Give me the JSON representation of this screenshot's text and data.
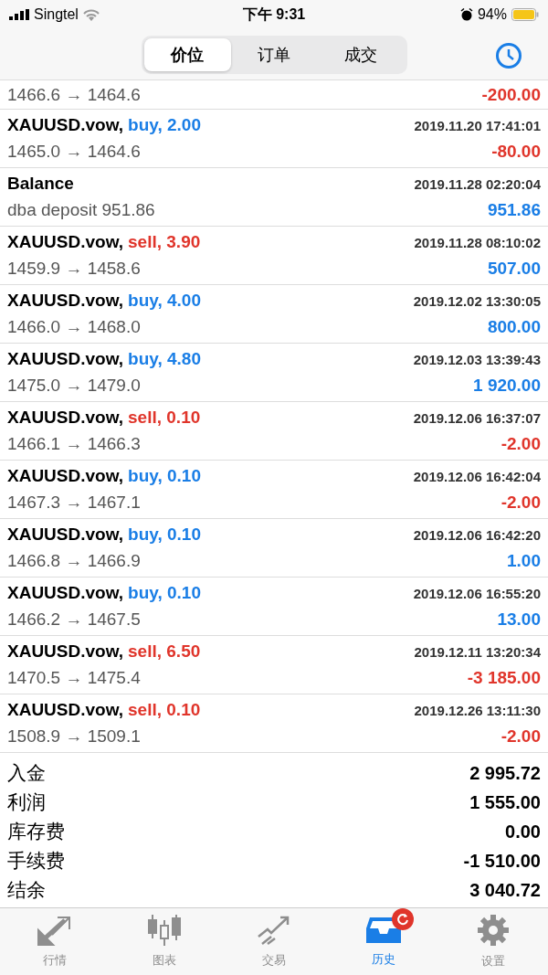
{
  "status_bar": {
    "carrier": "Singtel",
    "time": "下午 9:31",
    "battery": "94%"
  },
  "segments": [
    {
      "label": "价位",
      "selected": true
    },
    {
      "label": "订单",
      "selected": false
    },
    {
      "label": "成交",
      "selected": false
    }
  ],
  "deals": [
    {
      "kind": "partial",
      "prices": "1466.6 → 1464.6",
      "profit": "-200.00",
      "negative": true
    },
    {
      "kind": "trade",
      "symbol": "XAUUSD.vow,",
      "sell": false,
      "order": "buy, 2.00",
      "time": "2019.11.20 17:41:01",
      "prices": "1465.0 → 1464.6",
      "profit": "-80.00",
      "negative": true
    },
    {
      "kind": "balance",
      "symbol": "Balance",
      "time": "2019.11.28 02:20:04",
      "prices": "dba deposit 951.86",
      "profit": "951.86",
      "negative": false
    },
    {
      "kind": "trade",
      "symbol": "XAUUSD.vow,",
      "sell": true,
      "order": "sell, 3.90",
      "time": "2019.11.28 08:10:02",
      "prices": "1459.9 → 1458.6",
      "profit": "507.00",
      "negative": false
    },
    {
      "kind": "trade",
      "symbol": "XAUUSD.vow,",
      "sell": false,
      "order": "buy, 4.00",
      "time": "2019.12.02 13:30:05",
      "prices": "1466.0 → 1468.0",
      "profit": "800.00",
      "negative": false
    },
    {
      "kind": "trade",
      "symbol": "XAUUSD.vow,",
      "sell": false,
      "order": "buy, 4.80",
      "time": "2019.12.03 13:39:43",
      "prices": "1475.0 → 1479.0",
      "profit": "1 920.00",
      "negative": false
    },
    {
      "kind": "trade",
      "symbol": "XAUUSD.vow,",
      "sell": true,
      "order": "sell, 0.10",
      "time": "2019.12.06 16:37:07",
      "prices": "1466.1 → 1466.3",
      "profit": "-2.00",
      "negative": true
    },
    {
      "kind": "trade",
      "symbol": "XAUUSD.vow,",
      "sell": false,
      "order": "buy, 0.10",
      "time": "2019.12.06 16:42:04",
      "prices": "1467.3 → 1467.1",
      "profit": "-2.00",
      "negative": true
    },
    {
      "kind": "trade",
      "symbol": "XAUUSD.vow,",
      "sell": false,
      "order": "buy, 0.10",
      "time": "2019.12.06 16:42:20",
      "prices": "1466.8 → 1466.9",
      "profit": "1.00",
      "negative": false
    },
    {
      "kind": "trade",
      "symbol": "XAUUSD.vow,",
      "sell": false,
      "order": "buy, 0.10",
      "time": "2019.12.06 16:55:20",
      "prices": "1466.2 → 1467.5",
      "profit": "13.00",
      "negative": false
    },
    {
      "kind": "trade",
      "symbol": "XAUUSD.vow,",
      "sell": true,
      "order": "sell, 6.50",
      "time": "2019.12.11 13:20:34",
      "prices": "1470.5 → 1475.4",
      "profit": "-3 185.00",
      "negative": true
    },
    {
      "kind": "trade",
      "symbol": "XAUUSD.vow,",
      "sell": true,
      "order": "sell, 0.10",
      "time": "2019.12.26 13:11:30",
      "prices": "1508.9 → 1509.1",
      "profit": "-2.00",
      "negative": true
    }
  ],
  "summary": [
    {
      "label": "入金",
      "value": "2 995.72"
    },
    {
      "label": "利润",
      "value": "1 555.00"
    },
    {
      "label": "库存费",
      "value": "0.00"
    },
    {
      "label": "手续费",
      "value": "-1 510.00"
    },
    {
      "label": "结余",
      "value": "3 040.72"
    }
  ],
  "tab_bar": [
    {
      "kind": "quotes",
      "label": "行情",
      "selected": false
    },
    {
      "kind": "chart",
      "label": "图表",
      "selected": false
    },
    {
      "kind": "trade",
      "label": "交易",
      "selected": false
    },
    {
      "kind": "history",
      "label": "历史",
      "selected": true,
      "badge": true
    },
    {
      "kind": "settings",
      "label": "设置",
      "selected": false
    }
  ]
}
